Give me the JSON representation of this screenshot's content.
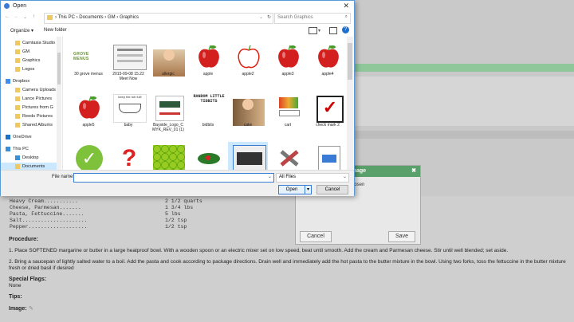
{
  "dialog": {
    "title": "Open",
    "path": [
      "This PC",
      "Documents",
      "GM",
      "Graphics"
    ],
    "search_placeholder": "Search Graphics",
    "organize_label": "Organize ▾",
    "new_folder_label": "New folder",
    "file_name_label": "File name:",
    "file_name_value": "",
    "filter_value": "All Files",
    "open_label": "Open",
    "cancel_label": "Cancel"
  },
  "nav": {
    "items": [
      "Camtasia Studio",
      "GM",
      "Graphics",
      "Logos",
      "Dropbox",
      "Camera Uploads",
      "Lance Pictures",
      "Pictures from G",
      "Reeds Pictures",
      "Shared Albums",
      "OneDrive",
      "This PC",
      "Desktop",
      "Documents"
    ]
  },
  "files": [
    {
      "caption": "30 grove menus",
      "thumb_text": "GROVE MENUS",
      "icon": "grove-logo-icon"
    },
    {
      "caption": "2015-09-08 15.22 Meet Now",
      "icon": "video-frame-icon"
    },
    {
      "caption": "allergic",
      "icon": "child-photo-icon"
    },
    {
      "caption": "apple",
      "icon": "red-apple-icon"
    },
    {
      "caption": "apple2",
      "icon": "apple-outline-icon"
    },
    {
      "caption": "apple3",
      "icon": "red-apple-icon"
    },
    {
      "caption": "apple4",
      "icon": "red-apple-icon"
    },
    {
      "caption": "apple5",
      "icon": "red-apple-icon"
    },
    {
      "caption": "baby",
      "thumb_text": "keep the tub full!",
      "icon": "bathtub-icon"
    },
    {
      "caption": "Bayside_Logo_C MYK_REV_01 (1)",
      "icon": "pdf-document-icon"
    },
    {
      "caption": "bidbits",
      "thumb_text": "RANDOM LITTLE TIDBITS",
      "icon": "text-graphic-icon"
    },
    {
      "caption": "cake",
      "icon": "cake-photo-icon"
    },
    {
      "caption": "cart",
      "icon": "cart-icon"
    },
    {
      "caption": "check mark 2",
      "icon": "checkbox-icon"
    },
    {
      "caption": "",
      "icon": "green-check-icon"
    },
    {
      "caption": "",
      "icon": "question-mark-icon"
    },
    {
      "caption": "",
      "icon": "apples-grid-icon"
    },
    {
      "caption": "",
      "icon": "holly-icon"
    },
    {
      "caption": "",
      "icon": "sign-photo-icon"
    },
    {
      "caption": "",
      "icon": "tools-icon"
    },
    {
      "caption": "",
      "icon": "video-file-icon"
    }
  ],
  "background": {
    "ingredients": [
      {
        "name": "Heavy Cream...........",
        "qty": "2 1/2 quarts"
      },
      {
        "name": "Cheese, Parmesan.......",
        "qty": "1 3/4 lbs"
      },
      {
        "name": "Pasta, Fettuccine.......",
        "qty": "5 lbs"
      },
      {
        "name": "Salt.....................",
        "qty": "1/2 tsp"
      },
      {
        "name": "Pepper...................",
        "qty": "1/2 tsp"
      }
    ],
    "procedure_label": "Procedure:",
    "step1": "1. Place SOFTENED margarine or butter in a large heatproof bowl. With a wooden spoon or an electric mixer set on low speed, beat until smooth. Add the cream and Parmesan cheese. Stir until well blended; set aside.",
    "step2a": "2. Bring a saucepan of lightly salted water to a boil. Add the pasta and cook according to package directions. Drain well and immediately add the hot pasta to the butter mixture in the bowl. Using two forks, toss the fettuccine in the butter mixture",
    "step2b": "fresh or dried basil if desired",
    "special_flags_label": "Special Flags:",
    "special_flags_value": "None",
    "tips_label": "Tips:",
    "image_label": "Image:",
    "panel_title": "e Image",
    "panel_text": "hosen",
    "panel_cancel": "Cancel",
    "panel_save": "Save"
  }
}
